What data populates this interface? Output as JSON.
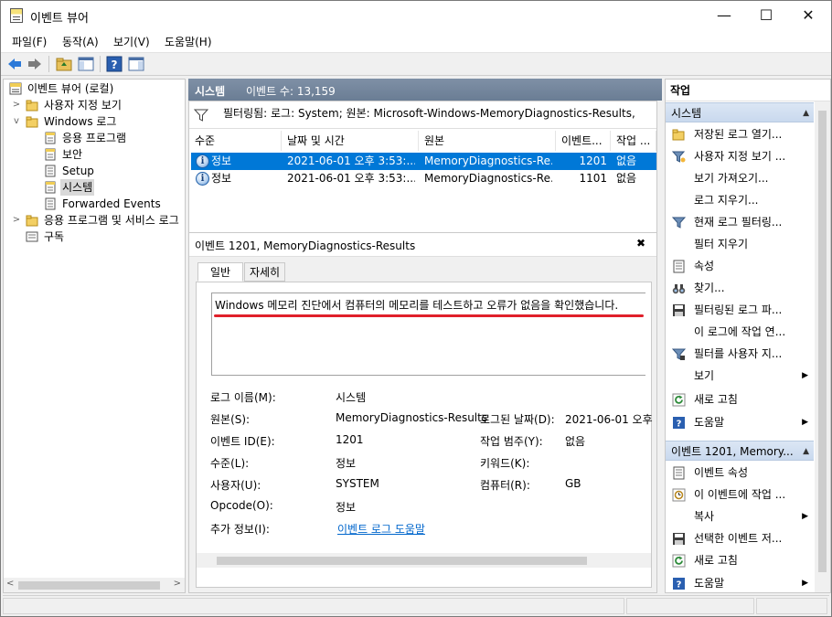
{
  "window": {
    "title": "이벤트 뷰어",
    "min_glyph": "—",
    "max_glyph": "☐",
    "close_glyph": "✕"
  },
  "menu": [
    "파일(F)",
    "동작(A)",
    "보기(V)",
    "도움말(H)"
  ],
  "tree": {
    "root": "이벤트 뷰어 (로컬)",
    "custom_views": "사용자 지정 보기",
    "windows_logs": "Windows 로그",
    "logs": [
      "응용 프로그램",
      "보안",
      "Setup",
      "시스템",
      "Forwarded Events"
    ],
    "app_service_logs": "응용 프로그램 및 서비스 로그",
    "subscriptions": "구독"
  },
  "center": {
    "log_name": "시스템",
    "event_count": "이벤트 수: 13,159",
    "filter_text": "필터링됨: 로그: System; 원본: Microsoft-Windows-MemoryDiagnostics-Results,",
    "columns": [
      "수준",
      "날짜 및 시간",
      "원본",
      "이벤트...",
      "작업 ..."
    ],
    "rows": [
      {
        "level": "정보",
        "datetime": "2021-06-01 오후 3:53:...",
        "source": "MemoryDiagnostics-Re...",
        "event_id": "1201",
        "task": "없음",
        "selected": true
      },
      {
        "level": "정보",
        "datetime": "2021-06-01 오후 3:53:...",
        "source": "MemoryDiagnostics-Re...",
        "event_id": "1101",
        "task": "없음",
        "selected": false
      }
    ],
    "info_glyph": "i"
  },
  "detail": {
    "title": "이벤트 1201, MemoryDiagnostics-Results",
    "close_glyph": "✖",
    "tabs": [
      "일반",
      "자세히"
    ],
    "message": "Windows 메모리 진단에서 컴퓨터의 메모리를 테스트하고 오류가 없음을 확인했습니다.",
    "fields": {
      "log_name_label": "로그 이름(M):",
      "log_name_value": "시스템",
      "source_label": "원본(S):",
      "source_value": "MemoryDiagnostics-Results",
      "logged_label": "로그된 날짜(D):",
      "logged_value": "2021-06-01 오후",
      "event_id_label": "이벤트 ID(E):",
      "event_id_value": "1201",
      "task_label": "작업 범주(Y):",
      "task_value": "없음",
      "level_label": "수준(L):",
      "level_value": "정보",
      "keywords_label": "키워드(K):",
      "keywords_value": "",
      "user_label": "사용자(U):",
      "user_value": "SYSTEM",
      "computer_label": "컴퓨터(R):",
      "computer_value": "GB",
      "opcode_label": "Opcode(O):",
      "opcode_value": "정보",
      "more_info_label": "추가 정보(I):",
      "more_info_link": "이벤트 로그 도움말"
    }
  },
  "actions": {
    "title": "작업",
    "section1": "시스템",
    "items1": [
      "저장된 로그 열기...",
      "사용자 지정 보기 ...",
      "보기 가져오기...",
      "로그 지우기...",
      "현재 로그 필터링...",
      "필터 지우기",
      "속성",
      "찾기...",
      "필터링된 로그 파...",
      "이 로그에 작업 연...",
      "필터를 사용자 지...",
      "보기",
      "새로 고침",
      "도움말"
    ],
    "section2": "이벤트 1201, Memory...",
    "items2": [
      "이벤트 속성",
      "이 이벤트에 작업 ...",
      "복사",
      "선택한 이벤트 저...",
      "새로 고침",
      "도움말"
    ],
    "caret_glyph": "▲",
    "submenu_glyph": "▶"
  }
}
